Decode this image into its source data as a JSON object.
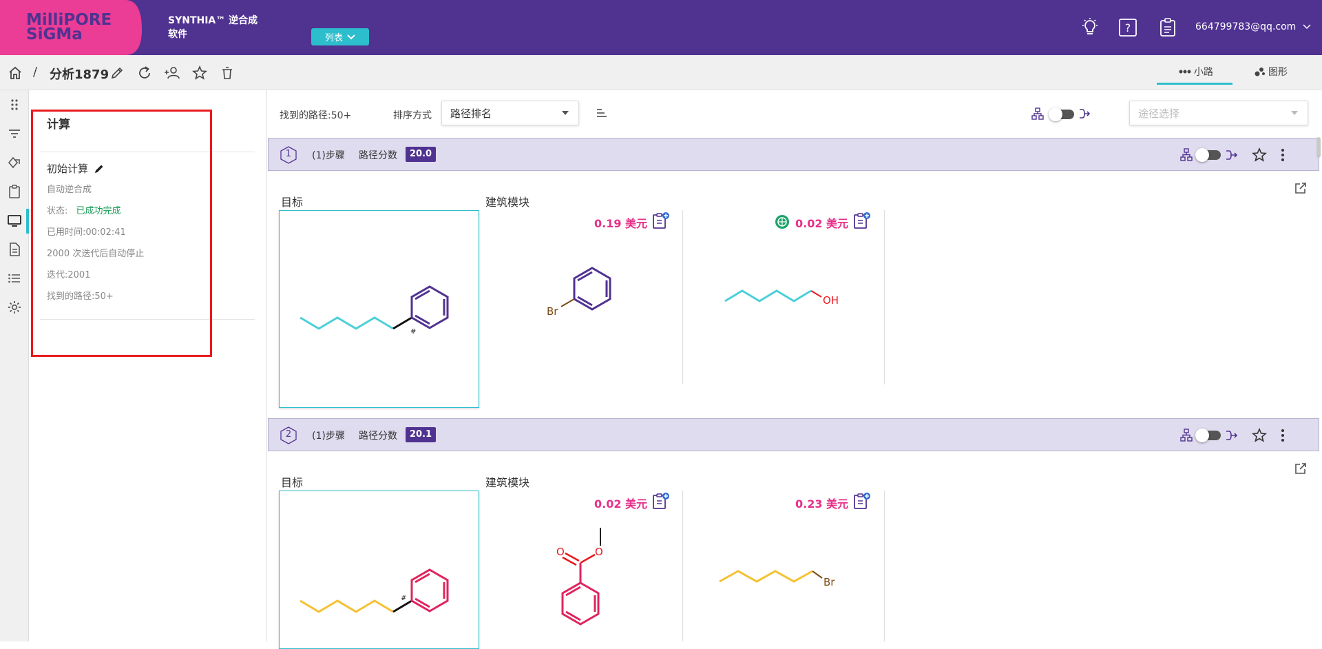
{
  "header": {
    "brand_line1": "SYNTHIA™ 逆合成",
    "brand_line2": "软件",
    "view_button": "列表",
    "user_email": "664799783@qq.com"
  },
  "breadcrumb": {
    "separator": "/",
    "title": "分析1879",
    "tabs": [
      {
        "label": "小路"
      },
      {
        "label": "图形"
      }
    ]
  },
  "panel": {
    "title": "计算",
    "calc_name": "初始计算",
    "mode": "自动逆合成",
    "status_label": "状态:",
    "status_value": "已成功完成",
    "elapsed": "已用时间:00:02:41",
    "stop_rule": "2000 次迭代后自动停止",
    "iterations": "迭代:2001",
    "routes_found": "找到的路径:50+"
  },
  "toolbar": {
    "routes_found": "找到的路径:50+",
    "sort_label": "排序方式",
    "sort_value": "路径排名",
    "route_select_placeholder": "途径选择"
  },
  "routes": [
    {
      "index": "1",
      "steps": "(1)步骤",
      "score_label": "路径分数",
      "score": "20.0",
      "target_label": "目标",
      "blocks_label": "建筑模块",
      "blocks": [
        {
          "price": "0.19 美元"
        },
        {
          "price": "0.02 美元"
        }
      ]
    },
    {
      "index": "2",
      "steps": "(1)步骤",
      "score_label": "路径分数",
      "score": "20.1",
      "target_label": "目标",
      "blocks_label": "建筑模块",
      "blocks": [
        {
          "price": "0.02 美元"
        },
        {
          "price": "0.23 美元"
        }
      ]
    }
  ],
  "molecules": {
    "hash_mark": "#",
    "bromine": "Br",
    "hydroxyl": "OH",
    "oxygen": "O"
  },
  "colors": {
    "header": "#503291",
    "accent": "#2dbecd",
    "price": "#e6308a",
    "success": "#1a9e57",
    "highlight": "#e8191e"
  }
}
